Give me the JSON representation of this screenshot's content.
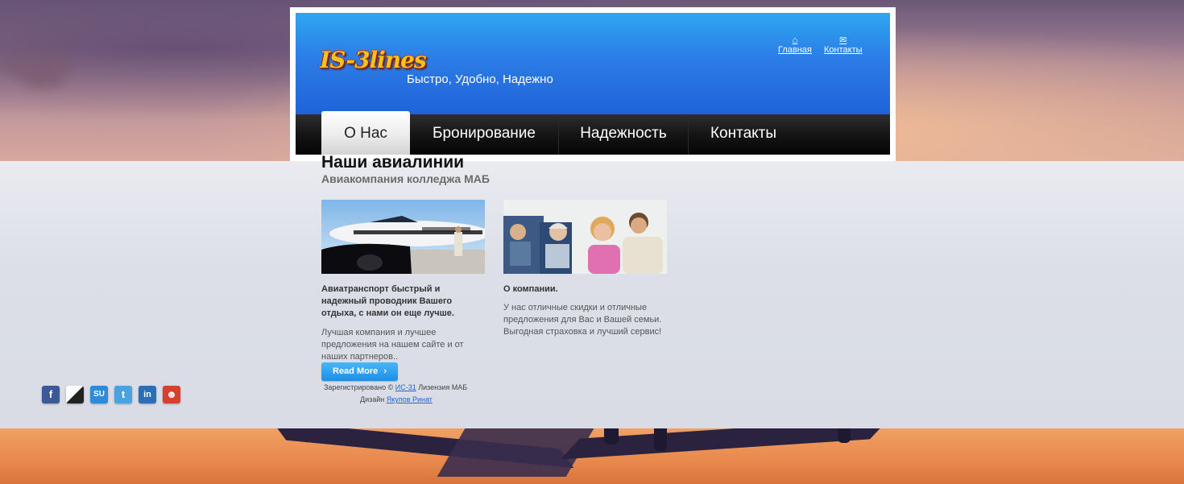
{
  "brand": {
    "logo": "IS-3lines",
    "slogan": "Быстро, Удобно, Надежно"
  },
  "top_links": [
    {
      "label": "Главная",
      "icon": "home-icon"
    },
    {
      "label": "Контакты",
      "icon": "mail-icon"
    }
  ],
  "nav": [
    {
      "label": "О Нас",
      "active": true
    },
    {
      "label": "Бронирование",
      "active": false
    },
    {
      "label": "Надежность",
      "active": false
    },
    {
      "label": "Контакты",
      "active": false
    }
  ],
  "main": {
    "title": "Наши авиалинии",
    "subtitle": "Авиакомпания колледжа МАБ",
    "col1": {
      "heading": "Авиатранспорт быстрый и надежный проводник Вашего отдыха, с нами он еще лучше.",
      "body": "Лучшая компания и лучшее предложения на нашем сайте и от наших партнеров.."
    },
    "col2": {
      "heading": "О компании.",
      "body": "У нас отличные скидки и отличные предложения для Вас и Вашей семьи. Выгодная страховка и лучший сервис!"
    },
    "read_more": "Read More",
    "read_more_arrow": "›"
  },
  "footer": {
    "line1_prefix": "Зарегистрировано ©",
    "line1_link": "ИС-31",
    "line1_suffix": "Лизензия МАБ",
    "line2_prefix": "Дизайн",
    "line2_link": "Якупов Ринат"
  },
  "social": [
    {
      "name": "facebook-icon",
      "glyph": "f",
      "color": "#3b5998"
    },
    {
      "name": "delicious-icon",
      "glyph": "",
      "color": "#222222"
    },
    {
      "name": "stumbleupon-icon",
      "glyph": "SU",
      "color": "#2d8bd8"
    },
    {
      "name": "twitter-icon",
      "glyph": "t",
      "color": "#4aa3df"
    },
    {
      "name": "linkedin-icon",
      "glyph": "in",
      "color": "#2a6fb5"
    },
    {
      "name": "reddit-icon",
      "glyph": "☻",
      "color": "#d6412e"
    }
  ]
}
